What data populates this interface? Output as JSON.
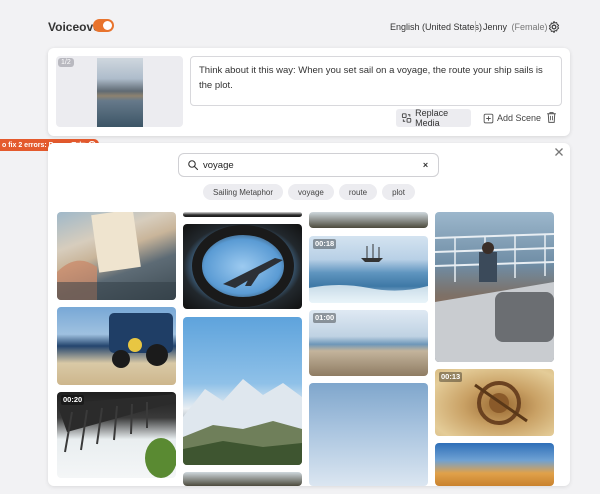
{
  "header": {
    "voiceover_label": "Voiceover",
    "voiceover_enabled": true,
    "language": "English (United States)",
    "voice_name": "Jenny",
    "voice_gender": "(Female)"
  },
  "scene": {
    "number": "1/2",
    "script_text": "Think about it this way: When you set sail on a voyage, the route your ship sails is the plot.",
    "replace_media_label": "Replace Media",
    "add_scene_label": "Add Scene"
  },
  "error_banner": {
    "prefix": "o fix 2 errors: Press",
    "key": "Tab"
  },
  "media_search": {
    "query": "voyage",
    "chips": [
      "Sailing Metaphor",
      "voyage",
      "route",
      "plot"
    ]
  },
  "media_results": {
    "durations": [
      "00:18",
      "01:00",
      "00:20",
      "00:13"
    ]
  },
  "colors": {
    "accent": "#e8742e",
    "error": "#e45a2d",
    "background": "#f2f2f4"
  }
}
